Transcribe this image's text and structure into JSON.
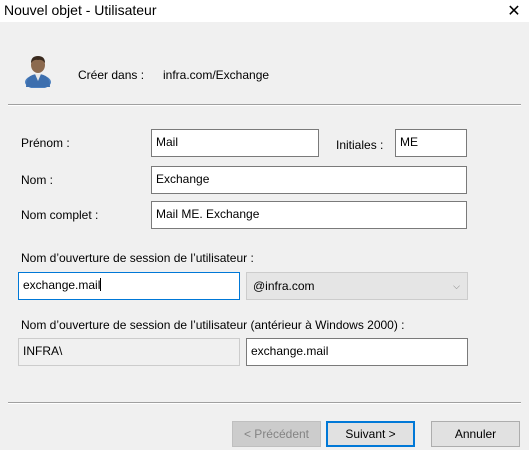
{
  "window": {
    "title": "Nouvel objet - Utilisateur",
    "close_glyph": "✕"
  },
  "header": {
    "icon": "user-icon",
    "create_in_label": "Créer dans :",
    "create_in_path": "infra.com/Exchange"
  },
  "form": {
    "first_name": {
      "label": "Prénom :",
      "value": "Mail"
    },
    "initials": {
      "label": "Initiales :",
      "value": "ME"
    },
    "last_name": {
      "label": "Nom :",
      "value": "Exchange"
    },
    "full_name": {
      "label": "Nom complet :",
      "value": "Mail ME. Exchange"
    },
    "logon_name": {
      "label": "Nom d’ouverture de session de l’utilisateur :",
      "value": "exchange.mail",
      "domain": "@infra.com"
    },
    "pre2000_logon": {
      "label": "Nom d’ouverture de session de l’utilisateur (antérieur à Windows 2000) :",
      "domain_prefix": "INFRA\\",
      "value": "exchange.mail"
    }
  },
  "buttons": {
    "back": "< Précédent",
    "next": "Suivant >",
    "cancel": "Annuler"
  },
  "colors": {
    "dialog_bg": "#f0f0f0",
    "focus_border": "#0078d7"
  }
}
